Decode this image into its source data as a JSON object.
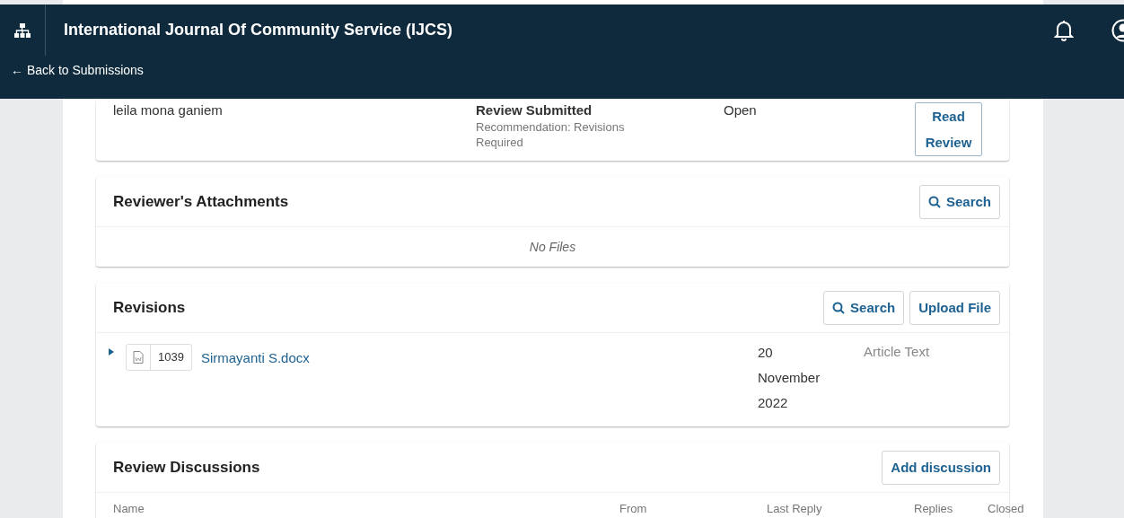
{
  "header": {
    "title": "International Journal Of Community Service (IJCS)",
    "back_link": "← Back to Submissions"
  },
  "reviewers": [
    {
      "name": "leila mona ganiem",
      "status": "Review Submitted",
      "recommendation": "Recommendation: Revisions Required",
      "state": "Open",
      "action": "Read Review"
    }
  ],
  "attachments": {
    "title": "Reviewer's Attachments",
    "search": "Search",
    "empty": "No Files"
  },
  "revisions": {
    "title": "Revisions",
    "buttons": [
      {
        "kind": "search",
        "label": "Search"
      },
      {
        "kind": "plain",
        "label": "Upload File"
      }
    ],
    "files": [
      {
        "expanded": false,
        "id": "1039",
        "name": "Sirmayanti S.docx",
        "date": "20 November 2022",
        "type": "Article Text"
      }
    ]
  },
  "discussions": {
    "title": "Review Discussions",
    "add": "Add discussion",
    "columns": [
      "Name",
      "From",
      "Last Reply",
      "Replies",
      "Closed"
    ]
  }
}
